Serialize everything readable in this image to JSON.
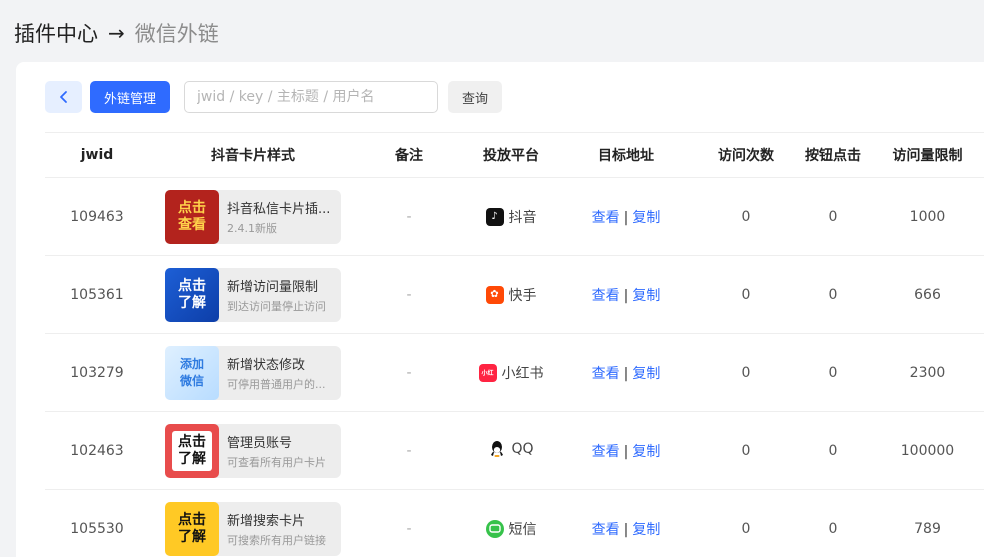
{
  "header": {
    "crumb_root": "插件中心",
    "arrow": "→",
    "crumb_current": "微信外链"
  },
  "toolbar": {
    "back_icon": "chevron-left-icon",
    "manage_label": "外链管理",
    "search_placeholder": "jwid / key / 主标题 / 用户名",
    "search_value": "",
    "query_label": "查询"
  },
  "table": {
    "columns": [
      "jwid",
      "抖音卡片样式",
      "备注",
      "投放平台",
      "目标地址",
      "访问次数",
      "按钮点击",
      "访问量限制"
    ],
    "rows": [
      {
        "jwid": "109463",
        "thumb_text": [
          "点击",
          "查看"
        ],
        "thumb_style": "red",
        "card_title": "抖音私信卡片插...",
        "card_sub": "2.4.1新版",
        "note": "-",
        "platform": "抖音",
        "platform_icon": "douyin-icon",
        "view_label": "查看",
        "sep": "|",
        "copy_label": "复制",
        "visits": "0",
        "clicks": "0",
        "limit": "1000"
      },
      {
        "jwid": "105361",
        "thumb_text": [
          "点击",
          "了解"
        ],
        "thumb_style": "blue",
        "card_title": "新增访问量限制",
        "card_sub": "到达访问量停止访问",
        "note": "-",
        "platform": "快手",
        "platform_icon": "kuaishou-icon",
        "view_label": "查看",
        "sep": "|",
        "copy_label": "复制",
        "visits": "0",
        "clicks": "0",
        "limit": "666"
      },
      {
        "jwid": "103279",
        "thumb_text": [
          "添加",
          "微信"
        ],
        "thumb_style": "lightblue",
        "card_title": "新增状态修改",
        "card_sub": "可停用普通用户的...",
        "note": "-",
        "platform": "小红书",
        "platform_icon": "xiaohongshu-icon",
        "view_label": "查看",
        "sep": "|",
        "copy_label": "复制",
        "visits": "0",
        "clicks": "0",
        "limit": "2300"
      },
      {
        "jwid": "102463",
        "thumb_text": [
          "点击",
          "了解"
        ],
        "thumb_style": "pinkred",
        "card_title": "管理员账号",
        "card_sub": "可查看所有用户卡片",
        "note": "-",
        "platform": "QQ",
        "platform_icon": "qq-icon",
        "view_label": "查看",
        "sep": "|",
        "copy_label": "复制",
        "visits": "0",
        "clicks": "0",
        "limit": "100000"
      },
      {
        "jwid": "105530",
        "thumb_text": [
          "点击",
          "了解"
        ],
        "thumb_style": "yellow",
        "card_title": "新增搜索卡片",
        "card_sub": "可搜索所有用户链接",
        "note": "-",
        "platform": "短信",
        "platform_icon": "sms-icon",
        "view_label": "查看",
        "sep": "|",
        "copy_label": "复制",
        "visits": "0",
        "clicks": "0",
        "limit": "789"
      }
    ]
  },
  "colors": {
    "primary": "#2f6bff",
    "page_bg": "#f2f3f5",
    "link": "#2f6bff"
  }
}
